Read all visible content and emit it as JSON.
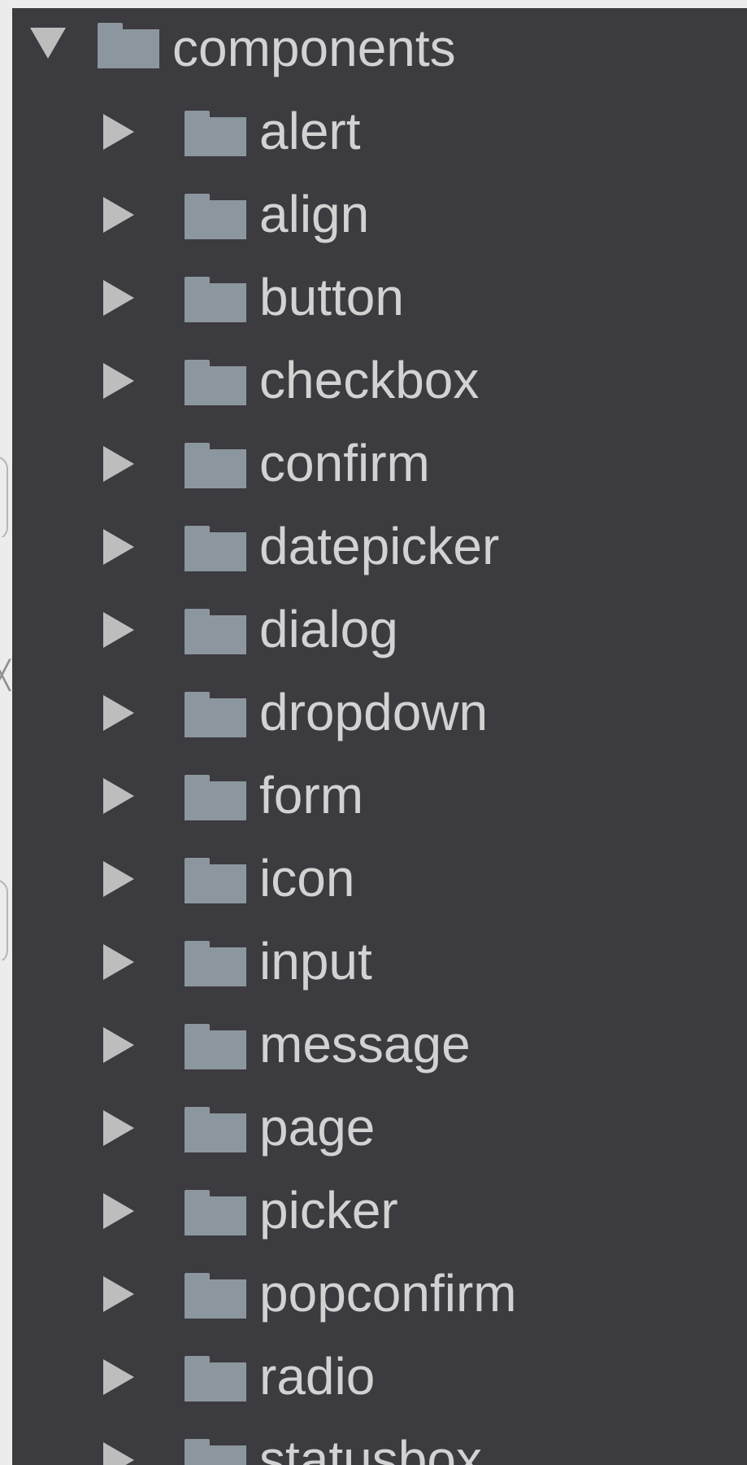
{
  "tree": {
    "root": {
      "label": "components",
      "icon": "folder-icon",
      "toggle_icon": "expand-arrow-down-icon"
    },
    "children": [
      {
        "label": "alert",
        "icon": "folder-icon",
        "toggle_icon": "collapse-arrow-right-icon"
      },
      {
        "label": "align",
        "icon": "folder-icon",
        "toggle_icon": "collapse-arrow-right-icon"
      },
      {
        "label": "button",
        "icon": "folder-icon",
        "toggle_icon": "collapse-arrow-right-icon"
      },
      {
        "label": "checkbox",
        "icon": "folder-icon",
        "toggle_icon": "collapse-arrow-right-icon"
      },
      {
        "label": "confirm",
        "icon": "folder-icon",
        "toggle_icon": "collapse-arrow-right-icon"
      },
      {
        "label": "datepicker",
        "icon": "folder-icon",
        "toggle_icon": "collapse-arrow-right-icon"
      },
      {
        "label": "dialog",
        "icon": "folder-icon",
        "toggle_icon": "collapse-arrow-right-icon"
      },
      {
        "label": "dropdown",
        "icon": "folder-icon",
        "toggle_icon": "collapse-arrow-right-icon"
      },
      {
        "label": "form",
        "icon": "folder-icon",
        "toggle_icon": "collapse-arrow-right-icon"
      },
      {
        "label": "icon",
        "icon": "folder-icon",
        "toggle_icon": "collapse-arrow-right-icon"
      },
      {
        "label": "input",
        "icon": "folder-icon",
        "toggle_icon": "collapse-arrow-right-icon"
      },
      {
        "label": "message",
        "icon": "folder-icon",
        "toggle_icon": "collapse-arrow-right-icon"
      },
      {
        "label": "page",
        "icon": "folder-icon",
        "toggle_icon": "collapse-arrow-right-icon"
      },
      {
        "label": "picker",
        "icon": "folder-icon",
        "toggle_icon": "collapse-arrow-right-icon"
      },
      {
        "label": "popconfirm",
        "icon": "folder-icon",
        "toggle_icon": "collapse-arrow-right-icon"
      },
      {
        "label": "radio",
        "icon": "folder-icon",
        "toggle_icon": "collapse-arrow-right-icon"
      },
      {
        "label": "statusbox",
        "icon": "folder-icon",
        "toggle_icon": "collapse-arrow-right-icon"
      }
    ]
  },
  "colors": {
    "panel_background": "#3c3b3f",
    "page_background": "#ececec",
    "text": "#d2d2d2",
    "arrow": "#bdbdbd",
    "folder": "#8c969e"
  }
}
